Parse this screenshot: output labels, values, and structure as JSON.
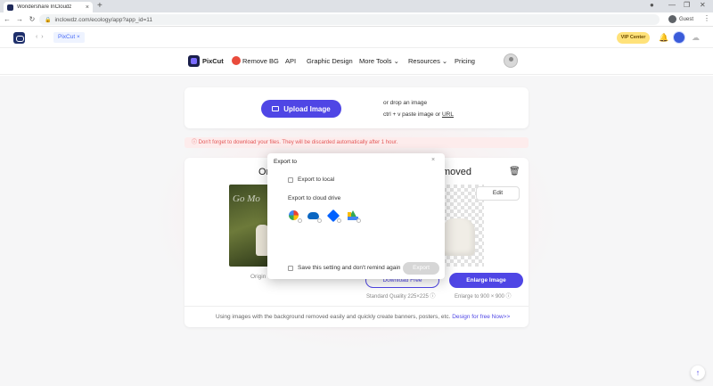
{
  "browser": {
    "tab_title": "Wondershare InCloudz",
    "tab_close": "×",
    "new_tab": "+",
    "url": "inclowdz.com/ecology/app?app_id=11",
    "profile_label": "Guest",
    "menu": "⋮",
    "back": "←",
    "forward": "→",
    "reload": "↻",
    "minimize": "—",
    "maximize": "❐",
    "close": "✕"
  },
  "app_header": {
    "nav_arrows": "‹ ›",
    "chip_label": "PixCut",
    "chip_close": "×",
    "vip_label": "VIP Center",
    "bell": "🔔"
  },
  "site_nav": {
    "logo_label": "PixCut",
    "items": [
      "Remove BG",
      "API",
      "Graphic Design",
      "More Tools ⌄",
      "Resources ⌄",
      "Pricing"
    ]
  },
  "upload": {
    "button_label": "Upload Image",
    "drop_text": "or drop an image",
    "paste_text": "ctrl + v paste image or ",
    "paste_link": "URL"
  },
  "warning": "ⓘ Don't forget to download your files. They will be discarded automatically after 1 hour.",
  "result": {
    "original_title": "Or",
    "removed_title": "moved",
    "original_caption": "Origin",
    "image_overlay_text": "Go Mo",
    "edit_label": "Edit",
    "download_label": "Download Free",
    "enlarge_label": "Enlarge Image",
    "standard_quality": "Standard Quality 225×225 ⓘ",
    "enlarge_to": "Enlarge to 900 × 900 ⓘ",
    "using_text": "Using images with the background removed easily and quickly create banners, posters, etc. ",
    "design_link": "Design for free Now>>",
    "trash": "🗑"
  },
  "modal": {
    "title": "Export to",
    "close": "×",
    "export_local": "Export to local",
    "export_cloud": "Export to cloud drive",
    "drives": [
      "google-photos-icon",
      "onedrive-icon",
      "dropbox-icon",
      "google-drive-icon"
    ],
    "remember": "Save this setting and don't remind again",
    "export_button": "Export"
  },
  "back_to_top": "↑"
}
